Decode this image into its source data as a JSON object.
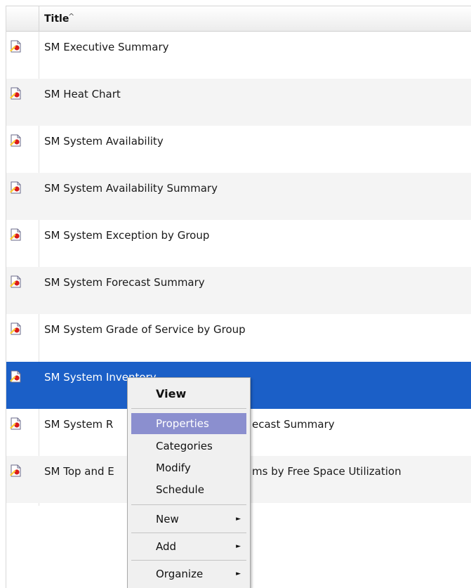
{
  "table": {
    "column_title": "Title",
    "sort_indicator": "^",
    "rows": [
      {
        "title": "SM Executive Summary",
        "icon": "report-icon"
      },
      {
        "title": "SM Heat Chart",
        "icon": "report-icon"
      },
      {
        "title": "SM System Availability",
        "icon": "report-icon"
      },
      {
        "title": "SM System Availability Summary",
        "icon": "report-icon"
      },
      {
        "title": "SM System Exception by Group",
        "icon": "report-icon"
      },
      {
        "title": "SM System Forecast Summary",
        "icon": "report-icon"
      },
      {
        "title": "SM System Grade of Service by Group",
        "icon": "report-icon"
      },
      {
        "title": "SM System Inventory",
        "icon": "report-icon"
      },
      {
        "title": "SM System R",
        "title_tail": "ecast Summary",
        "icon": "report-icon"
      },
      {
        "title": "SM Top and E",
        "title_tail": "ms by Free Space Utilization",
        "icon": "report-icon"
      }
    ]
  },
  "context_menu": {
    "view": "View",
    "properties": "Properties",
    "categories": "Categories",
    "modify": "Modify",
    "schedule": "Schedule",
    "new": "New",
    "add": "Add",
    "organize": "Organize",
    "submenu_arrow": "►"
  },
  "colors": {
    "selection": "#1b5fc7",
    "menu_highlight": "#8b8fcf",
    "alt_row": "#f4f4f4"
  }
}
